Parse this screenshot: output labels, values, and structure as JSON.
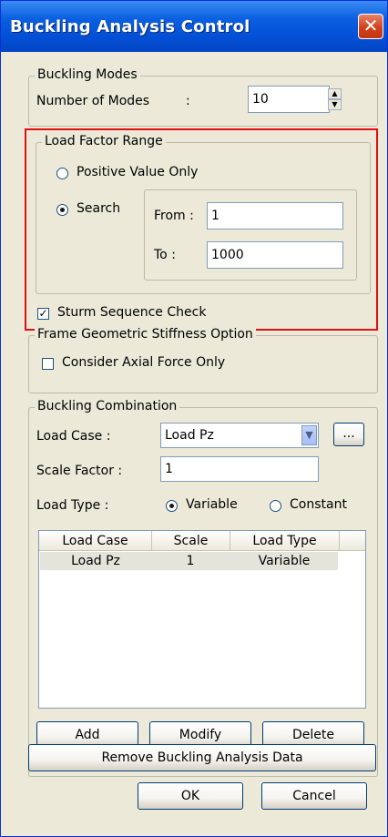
{
  "window": {
    "title": "Buckling Analysis Control",
    "close_icon": "close-icon"
  },
  "buckling_modes": {
    "legend": "Buckling Modes",
    "num_modes_label": "Number of Modes",
    "colon": ":",
    "num_modes_value": "10"
  },
  "load_factor": {
    "legend": "Load Factor Range",
    "positive_label": "Positive Value Only",
    "search_label": "Search",
    "selected": "Search",
    "from_label": "From :",
    "from_value": "1",
    "to_label": "To :",
    "to_value": "1000"
  },
  "sturm": {
    "label": "Sturm Sequence Check",
    "checked": true
  },
  "frame_geo": {
    "legend": "Frame Geometric Stiffness Option",
    "axial_label": "Consider Axial Force Only",
    "checked": false
  },
  "combination": {
    "legend": "Buckling Combination",
    "load_case_label": "Load Case :",
    "load_case_value": "Load Pz",
    "ellipsis_label": "...",
    "scale_factor_label": "Scale Factor :",
    "scale_factor_value": "1",
    "load_type_label": "Load Type :",
    "variable_label": "Variable",
    "constant_label": "Constant",
    "load_type_selected": "Variable",
    "columns": [
      "Load Case",
      "Scale",
      "Load Type"
    ],
    "rows": [
      {
        "load_case": "Load Pz",
        "scale": "1",
        "load_type": "Variable"
      }
    ],
    "add_label": "Add",
    "modify_label": "Modify",
    "delete_label": "Delete"
  },
  "remove_label": "Remove Buckling Analysis Data",
  "ok_label": "OK",
  "cancel_label": "Cancel",
  "colors": {
    "title_bar": "#0350d6",
    "dialog_bg": "#ece9d8",
    "highlight_box": "#e01010"
  }
}
